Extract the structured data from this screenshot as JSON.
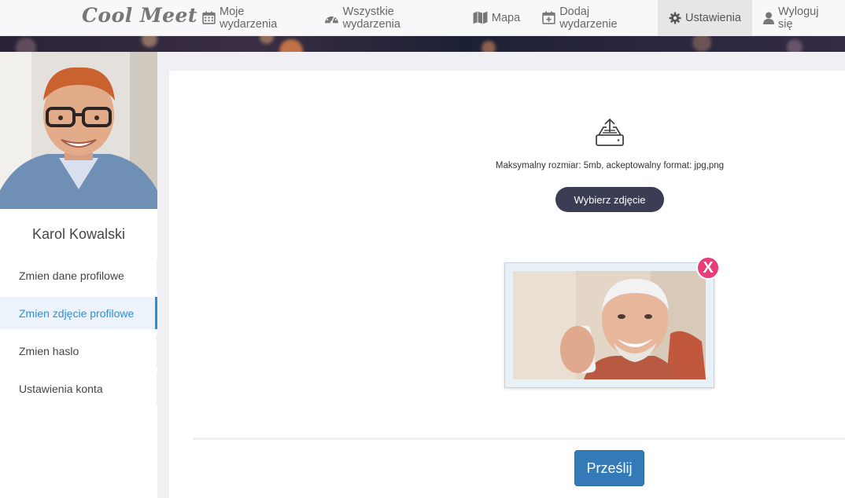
{
  "brand": {
    "name": "Cool Meet"
  },
  "nav": {
    "items": [
      {
        "label": "Moje wydarzenia",
        "icon": "calendar-icon"
      },
      {
        "label": "Wszystkie wydarzenia",
        "icon": "dashboard-icon"
      },
      {
        "label": "Mapa",
        "icon": "map-icon"
      },
      {
        "label": "Dodaj wydarzenie",
        "icon": "calendar-plus-icon"
      },
      {
        "label": "Ustawienia",
        "icon": "gear-icon",
        "active": true
      },
      {
        "label": "Wyloguj się",
        "icon": "user-icon"
      }
    ]
  },
  "sidebar": {
    "user_name": "Karol Kowalski",
    "items": [
      {
        "label": "Zmien dane profilowe"
      },
      {
        "label": "Zmien zdjęcie profilowe",
        "active": true
      },
      {
        "label": "Zmien haslo"
      },
      {
        "label": "Ustawienia konta"
      }
    ]
  },
  "upload": {
    "icon": "upload-tray-icon",
    "hint": "Maksymalny rozmiar: 5mb, ackeptowalny format: jpg,png",
    "choose_label": "Wybierz zdjęcie",
    "remove_label": "X",
    "submit_label": "Prześlij"
  },
  "colors": {
    "accent": "#2a8fd8",
    "choose_button": "#3b3d55",
    "submit_button": "#337ab7",
    "remove_button": "#e83d79"
  }
}
